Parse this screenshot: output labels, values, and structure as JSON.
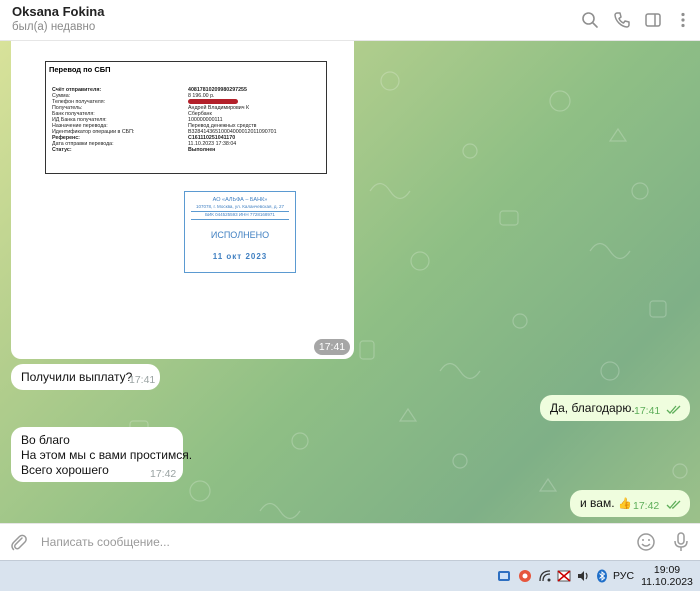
{
  "header": {
    "contact_name": "Oksana Fokina",
    "status": "был(а) недавно",
    "icons": [
      "search-icon",
      "phone-icon",
      "sidebar-toggle-icon",
      "more-icon"
    ]
  },
  "image_message": {
    "time": "17:41",
    "receipt": {
      "title": "Перевод по СБП",
      "rows": [
        {
          "label": "Счёт отправителя:",
          "value": "40817810209980297255",
          "bold": true
        },
        {
          "label": "Сумма:",
          "value": "8 196.00 р.",
          "bold": false
        },
        {
          "label": "Телефон получателя:",
          "value": "",
          "bold": false
        },
        {
          "label": "Получатель:",
          "value": "Андрей Владимирович К",
          "bold": false
        },
        {
          "label": "Банк получателя:",
          "value": "Сбербанк",
          "bold": false
        },
        {
          "label": "ИД Банка получателя:",
          "value": "100000000111",
          "bold": false
        },
        {
          "label": "Назначение перевода:",
          "value": "Перевод денежных средств",
          "bold": false
        },
        {
          "label": "Идентификатор операции в СБП:",
          "value": "B3284143651000400001201109070​1",
          "bold": false
        },
        {
          "label": "Референс:",
          "value": "C161110251041170",
          "bold": true
        },
        {
          "label": "Дата отправки перевода:",
          "value": "11.10.2023 17:38:04",
          "bold": false
        },
        {
          "label": "Статус:",
          "value": "Выполнен",
          "bold": true
        }
      ]
    },
    "stamp": {
      "bank": "АО «АЛЬФА – БАНК»",
      "address": "107078, г. Москва, ул. Каланчевская, д. 27",
      "bik": "БИК 044525593 ИНН 7728168971",
      "status": "ИСПОЛНЕНО",
      "date": "11 окт 2023"
    }
  },
  "messages": [
    {
      "dir": "in",
      "lines": [
        "Получили выплату?"
      ],
      "time": "17:41"
    },
    {
      "dir": "out",
      "lines": [
        "Да, благодарю."
      ],
      "time": "17:41",
      "read": true
    },
    {
      "dir": "in",
      "lines": [
        "Во благо",
        "На этом мы с вами простимся.",
        "Всего хорошего"
      ],
      "time": "17:42"
    },
    {
      "dir": "out",
      "lines": [
        "и вам."
      ],
      "time": "17:42",
      "read": true,
      "reaction": "👍"
    }
  ],
  "composer": {
    "placeholder": "Написать сообщение..."
  },
  "taskbar": {
    "language": "РУС",
    "time": "19:09",
    "date": "11.10.2023"
  },
  "colors": {
    "outgoing_bubble": "#effdde",
    "read_check": "#5eae5a",
    "stamp_blue": "#3f7fc1"
  }
}
